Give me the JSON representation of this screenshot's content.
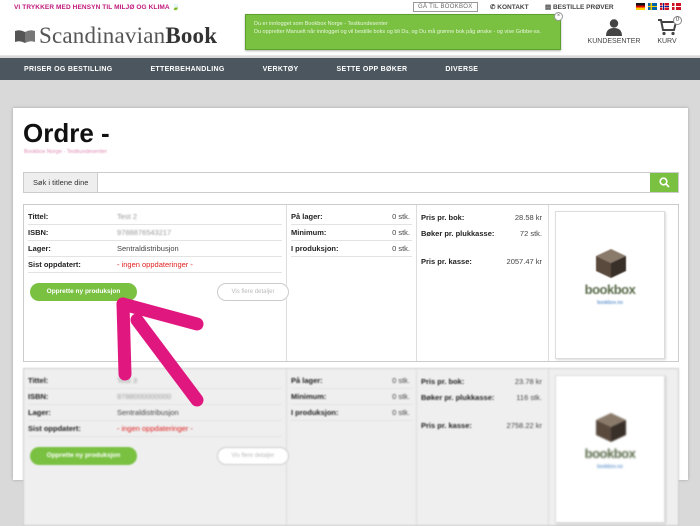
{
  "topbar": {
    "eco_text": "VI TRYKKER MED HENSYN TIL MILJØ OG KLIMA",
    "goto_label": "GÅ TIL BOOKBOX",
    "contact_label": "KONTAKT",
    "samples_label": "BESTILLE PRØVER",
    "flags": [
      "de",
      "se",
      "no",
      "dk"
    ]
  },
  "header": {
    "brand_light": "Scandinavian",
    "brand_bold": "Book",
    "customer_label": "KUNDESENTER",
    "cart_label": "KURV",
    "cart_count": "0"
  },
  "toast": {
    "line1": "Du er innlogget som Bookbox Norge - Testkundesenter",
    "line2": "Du oppretter Manuelt når innlogget og vil bestille boks og bli Du, og Du må grønne bok påg ønske - og vise Gribbe-ss."
  },
  "nav": {
    "items": [
      "PRISER OG BESTILLING",
      "ETTERBEHANDLING",
      "VERKTØY",
      "SETTE OPP BØKER",
      "DIVERSE"
    ]
  },
  "page": {
    "title": "Ordre -",
    "subtitle": "Bookbox Norge - Testkundesenter"
  },
  "search": {
    "label": "Søk i titlene dine",
    "placeholder": ""
  },
  "items": [
    {
      "labels": {
        "title": "Tittel:",
        "isbn": "ISBN:",
        "stock": "Lager:",
        "updated": "Sist oppdatert:"
      },
      "title": "Test 2",
      "isbn": "9788876543217",
      "stock": "Sentraldistribusjon",
      "updated": "- ingen oppdateringer -",
      "create_button": "Opprette ny produksjon",
      "details_button": "Vis flere detaljer",
      "inventory": [
        {
          "label": "På lager:",
          "value": "0 stk."
        },
        {
          "label": "Minimum:",
          "value": "0 stk."
        },
        {
          "label": "I produksjon:",
          "value": "0 stk."
        }
      ],
      "prices": [
        {
          "label": "Pris pr. bok:",
          "value": "28.58 kr"
        },
        {
          "label": "Bøker pr. plukkasse:",
          "value": "72 stk."
        },
        {
          "label": "Pris pr. kasse:",
          "value": "2057.47 kr"
        }
      ],
      "image": {
        "brand": "bookbox",
        "url": "bookbox.no"
      }
    },
    {
      "labels": {
        "title": "Tittel:",
        "isbn": "ISBN:",
        "stock": "Lager:",
        "updated": "Sist oppdatert:"
      },
      "title": "Test 3",
      "isbn": "9788000000000",
      "stock": "Sentraldistribusjon",
      "updated": "- ingen oppdateringer -",
      "create_button": "Opprette ny produksjon",
      "details_button": "Vis flere detaljer",
      "inventory": [
        {
          "label": "På lager:",
          "value": "0 stk."
        },
        {
          "label": "Minimum:",
          "value": "0 stk."
        },
        {
          "label": "I produksjon:",
          "value": "0 stk."
        }
      ],
      "prices": [
        {
          "label": "Pris pr. bok:",
          "value": "23.78 kr"
        },
        {
          "label": "Bøker pr. plukkasse:",
          "value": "116 stk."
        },
        {
          "label": "Pris pr. kasse:",
          "value": "2758.22 kr"
        }
      ],
      "image": {
        "brand": "bookbox",
        "url": "bookbox.no"
      }
    }
  ],
  "colors": {
    "accent_green": "#7ac142",
    "nav_bg": "#4b565e",
    "eco_pink": "#c0197a",
    "arrow_pink": "#e0177f",
    "warning_red": "#e02020"
  }
}
